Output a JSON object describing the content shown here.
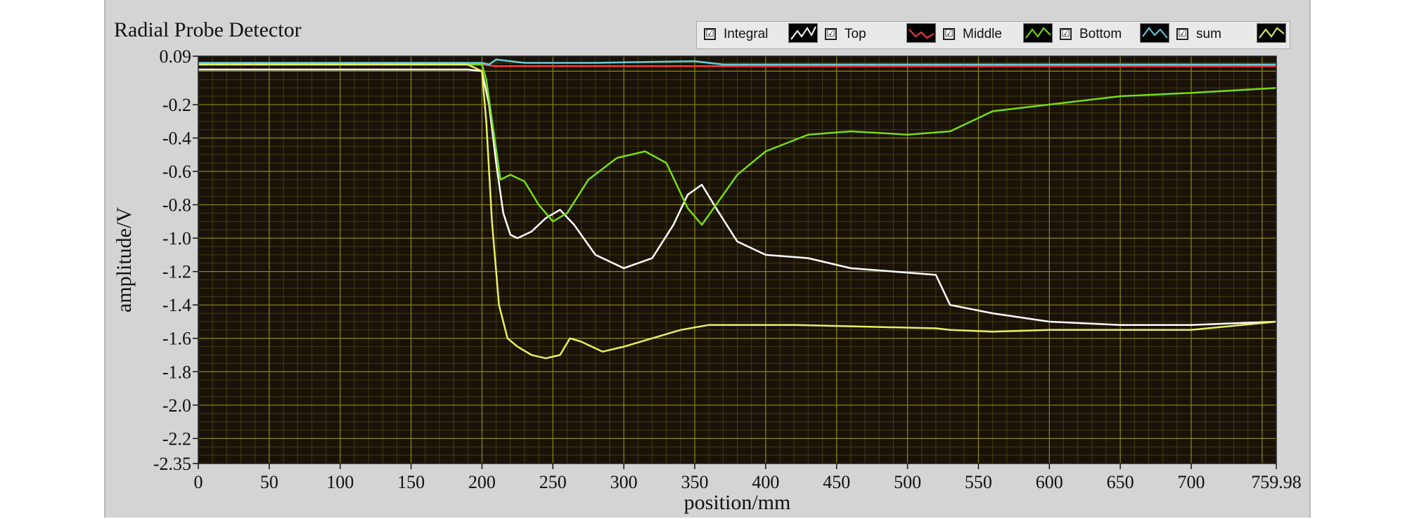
{
  "window": {
    "title": "Radial Probe Detector"
  },
  "legend": [
    {
      "label": "Integral",
      "checked": "☑",
      "color": "#ffffff"
    },
    {
      "label": "Top",
      "checked": "☑",
      "color": "#ff3b3b"
    },
    {
      "label": "Middle",
      "checked": "☑",
      "color": "#77dd11"
    },
    {
      "label": "Bottom",
      "checked": "☑",
      "color": "#66ccdd"
    },
    {
      "label": "sum",
      "checked": "☑",
      "color": "#e8f060"
    }
  ],
  "colors": {
    "plot_bg": "#1a1208",
    "grid_major": "#8a8a14",
    "grid_minor": "#3d3d10",
    "panel": "#d4d4d4"
  },
  "chart_data": {
    "type": "line",
    "title": "Radial Probe Detector",
    "xlabel": "position/mm",
    "ylabel": "amplitude/V",
    "xlim": [
      0,
      759.98
    ],
    "ylim": [
      -2.35,
      0.09
    ],
    "xticks": [
      "0",
      "50",
      "100",
      "150",
      "200",
      "250",
      "300",
      "350",
      "400",
      "450",
      "500",
      "550",
      "600",
      "650",
      "700",
      "759.98"
    ],
    "yticks": [
      "0.09",
      "-0.2",
      "-0.4",
      "-0.6",
      "-0.8",
      "-1.0",
      "-1.2",
      "-1.4",
      "-1.6",
      "-1.8",
      "-2.0",
      "-2.2",
      "-2.35"
    ],
    "grid": true,
    "legend_position": "top-right",
    "series": [
      {
        "name": "Integral",
        "color": "#ffffff",
        "x": [
          0,
          190,
          200,
          205,
          210,
          215,
          220,
          225,
          235,
          245,
          255,
          265,
          280,
          300,
          320,
          335,
          345,
          355,
          365,
          380,
          400,
          430,
          460,
          490,
          520,
          530,
          560,
          600,
          650,
          700,
          759.98
        ],
        "y": [
          0.01,
          0.01,
          0.0,
          -0.2,
          -0.55,
          -0.85,
          -0.98,
          -1.0,
          -0.96,
          -0.88,
          -0.83,
          -0.92,
          -1.1,
          -1.18,
          -1.12,
          -0.92,
          -0.74,
          -0.68,
          -0.82,
          -1.02,
          -1.1,
          -1.12,
          -1.18,
          -1.2,
          -1.22,
          -1.4,
          -1.45,
          -1.5,
          -1.52,
          -1.52,
          -1.5
        ]
      },
      {
        "name": "Top",
        "color": "#ff3b3b",
        "x": [
          0,
          200,
          210,
          300,
          400,
          500,
          600,
          700,
          759.98
        ],
        "y": [
          0.04,
          0.04,
          0.03,
          0.03,
          0.03,
          0.03,
          0.03,
          0.03,
          0.03
        ]
      },
      {
        "name": "Middle",
        "color": "#77dd11",
        "x": [
          0,
          200,
          203,
          208,
          213,
          220,
          230,
          240,
          250,
          260,
          275,
          295,
          315,
          330,
          345,
          355,
          365,
          380,
          400,
          430,
          460,
          500,
          530,
          560,
          600,
          650,
          700,
          759.98
        ],
        "y": [
          0.04,
          0.04,
          -0.05,
          -0.35,
          -0.65,
          -0.62,
          -0.66,
          -0.8,
          -0.9,
          -0.85,
          -0.65,
          -0.52,
          -0.48,
          -0.55,
          -0.82,
          -0.92,
          -0.8,
          -0.62,
          -0.48,
          -0.38,
          -0.36,
          -0.38,
          -0.36,
          -0.24,
          -0.2,
          -0.15,
          -0.13,
          -0.1
        ]
      },
      {
        "name": "Bottom",
        "color": "#66ccdd",
        "x": [
          0,
          200,
          205,
          210,
          230,
          280,
          350,
          370,
          400,
          500,
          600,
          700,
          759.98
        ],
        "y": [
          0.05,
          0.05,
          0.04,
          0.07,
          0.05,
          0.05,
          0.06,
          0.04,
          0.04,
          0.04,
          0.04,
          0.04,
          0.04
        ]
      },
      {
        "name": "sum",
        "color": "#e8f060",
        "x": [
          0,
          190,
          200,
          203,
          207,
          212,
          218,
          225,
          235,
          245,
          255,
          262,
          270,
          285,
          300,
          320,
          340,
          360,
          380,
          420,
          470,
          520,
          530,
          560,
          600,
          650,
          700,
          759.98
        ],
        "y": [
          0.04,
          0.04,
          0.0,
          -0.3,
          -0.9,
          -1.4,
          -1.6,
          -1.65,
          -1.7,
          -1.72,
          -1.7,
          -1.6,
          -1.62,
          -1.68,
          -1.65,
          -1.6,
          -1.55,
          -1.52,
          -1.52,
          -1.52,
          -1.53,
          -1.54,
          -1.55,
          -1.56,
          -1.55,
          -1.55,
          -1.55,
          -1.5
        ]
      }
    ]
  }
}
